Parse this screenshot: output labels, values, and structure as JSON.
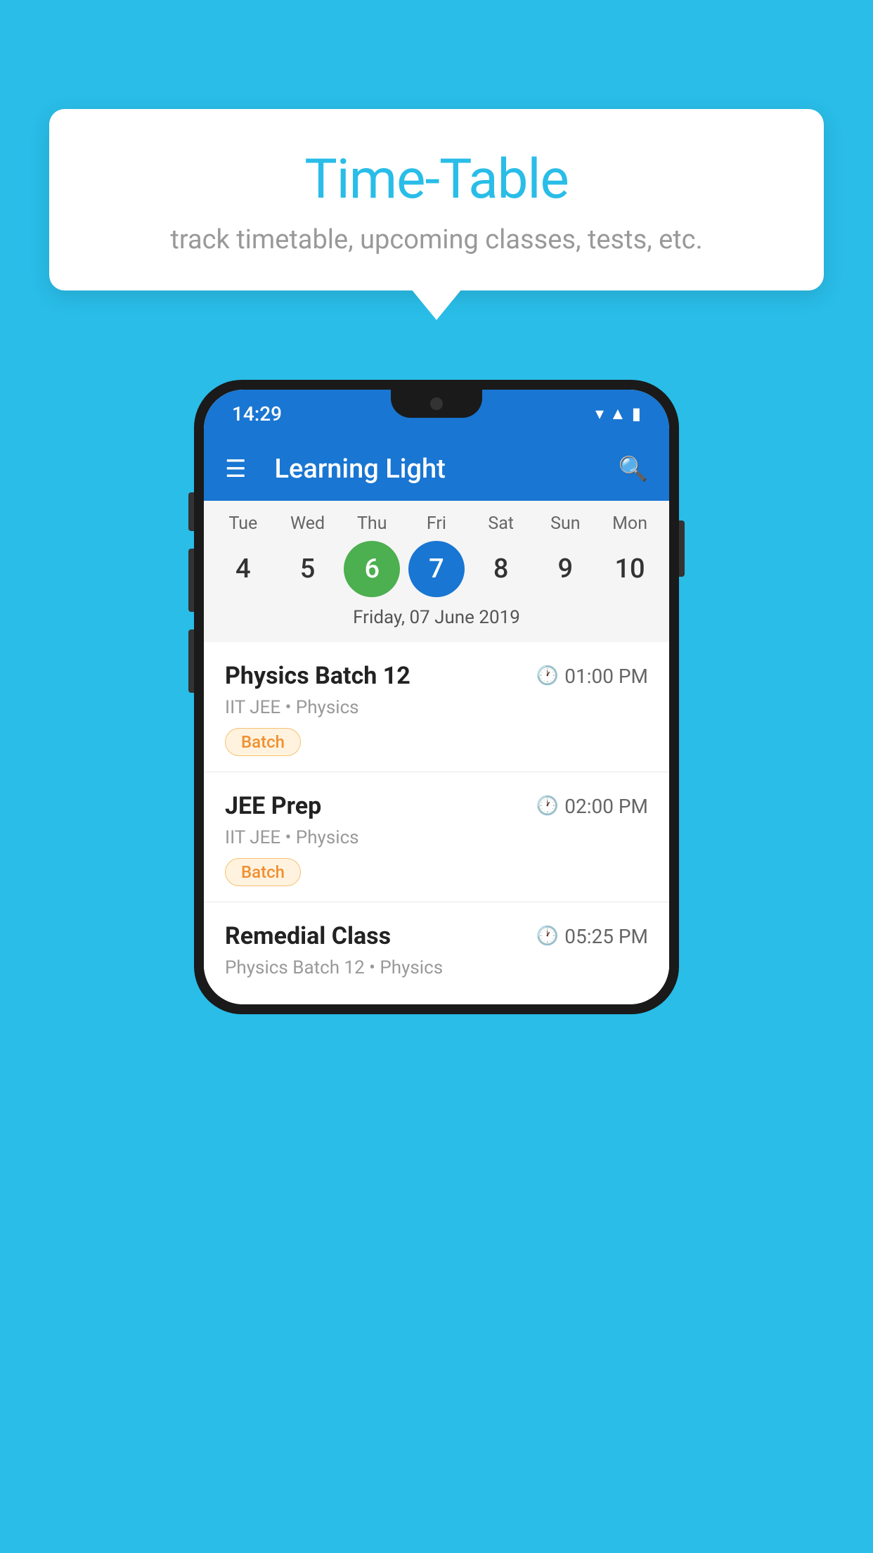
{
  "background_color": "#29bde8",
  "bubble": {
    "title": "Time-Table",
    "subtitle": "track timetable, upcoming classes, tests, etc."
  },
  "phone": {
    "status_bar": {
      "time": "14:29"
    },
    "app_bar": {
      "title": "Learning Light"
    },
    "calendar": {
      "days_of_week": [
        "Tue",
        "Wed",
        "Thu",
        "Fri",
        "Sat",
        "Sun",
        "Mon"
      ],
      "dates": [
        "4",
        "5",
        "6",
        "7",
        "8",
        "9",
        "10"
      ],
      "today_index": 2,
      "selected_index": 3,
      "selected_label": "Friday, 07 June 2019"
    },
    "schedule": [
      {
        "title": "Physics Batch 12",
        "time": "01:00 PM",
        "subtitle": "IIT JEE • Physics",
        "badge": "Batch"
      },
      {
        "title": "JEE Prep",
        "time": "02:00 PM",
        "subtitle": "IIT JEE • Physics",
        "badge": "Batch"
      },
      {
        "title": "Remedial Class",
        "time": "05:25 PM",
        "subtitle": "Physics Batch 12 • Physics",
        "badge": null
      }
    ]
  }
}
